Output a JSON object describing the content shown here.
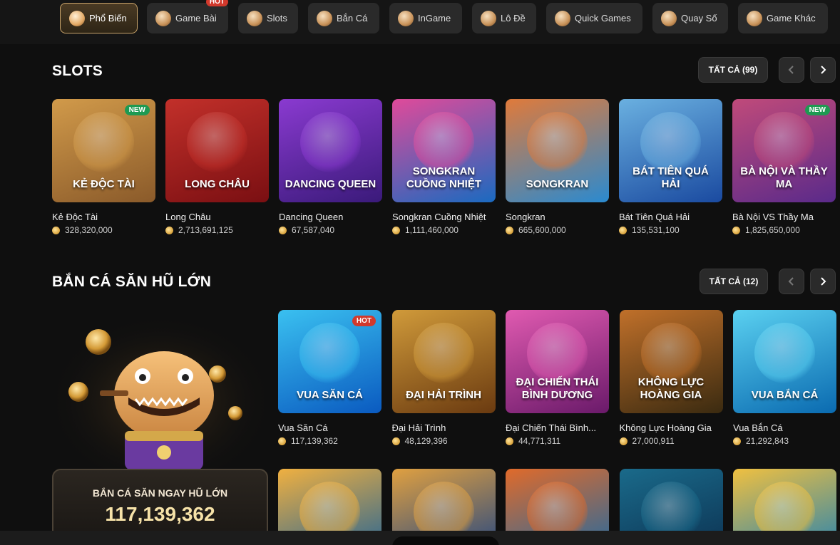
{
  "categories": [
    {
      "label": "Phổ Biến",
      "icon": "fire-icon",
      "active": true
    },
    {
      "label": "Game Bài",
      "icon": "cards-icon",
      "hot": "HOT"
    },
    {
      "label": "Slots",
      "icon": "slot-icon"
    },
    {
      "label": "Bắn Cá",
      "icon": "fish-icon"
    },
    {
      "label": "InGame",
      "icon": "gamepad-icon"
    },
    {
      "label": "Lô Đề",
      "icon": "lottery-ball-icon"
    },
    {
      "label": "Quick Games",
      "icon": "rocket-icon"
    },
    {
      "label": "Quay Số",
      "icon": "dice-icon"
    },
    {
      "label": "Game Khác",
      "icon": "controller-icon"
    }
  ],
  "slots": {
    "title": "SLOTS",
    "all_label": "TẤT CẢ (99)",
    "games": [
      {
        "thumb_title": "KẺ ĐỘC TÀI",
        "name": "Kẻ Độc Tài",
        "amount": "328,320,000",
        "badge": "NEW",
        "color1": "#8a5a2a",
        "color2": "#d19a4a"
      },
      {
        "thumb_title": "LONG CHÂU",
        "name": "Long Châu",
        "amount": "2,713,691,125",
        "color1": "#7a0f12",
        "color2": "#c2302a"
      },
      {
        "thumb_title": "DANCING QUEEN",
        "name": "Dancing Queen",
        "amount": "67,587,040",
        "color1": "#3a1a7a",
        "color2": "#8a3ad0"
      },
      {
        "thumb_title": "SONGKRAN CUỒNG NHIỆT",
        "name": "Songkran Cuồng Nhiệt",
        "amount": "1,111,460,000",
        "color1": "#1a6ac0",
        "color2": "#e04a9a"
      },
      {
        "thumb_title": "SONGKRAN",
        "name": "Songkran",
        "amount": "665,600,000",
        "color1": "#2a8ad0",
        "color2": "#e07a3a"
      },
      {
        "thumb_title": "BÁT TIÊN QUÁ HẢI",
        "name": "Bát Tiên Quá Hải",
        "amount": "135,531,100",
        "color1": "#1a4aa0",
        "color2": "#6ab0e0"
      },
      {
        "thumb_title": "BÀ NỘI VÀ THẦY MA",
        "name": "Bà Nội VS Thầy Ma",
        "amount": "1,825,650,000",
        "badge": "NEW",
        "color1": "#5a2a8a",
        "color2": "#c04a7a"
      }
    ]
  },
  "fishing": {
    "title": "BẮN CÁ SĂN HŨ LỚN",
    "all_label": "TẤT CẢ (12)",
    "promo_label": "BẮN CÁ SĂN NGAY HŨ LỚN",
    "promo_value": "117,139,362",
    "games": [
      {
        "thumb_title": "VUA SĂN CÁ",
        "name": "Vua Săn Cá",
        "amount": "117,139,362",
        "badge": "HOT",
        "color1": "#0a5ac0",
        "color2": "#3ac0f0"
      },
      {
        "thumb_title": "ĐẠI HẢI TRÌNH",
        "name": "Đại Hải Trình",
        "amount": "48,129,396",
        "color1": "#6a3a10",
        "color2": "#d09a3a"
      },
      {
        "thumb_title": "ĐẠI CHIẾN THÁI BÌNH DƯƠNG",
        "name": "Đại Chiến Thái Bình...",
        "amount": "44,771,311",
        "color1": "#6a1a6a",
        "color2": "#e05ab0"
      },
      {
        "thumb_title": "KHÔNG LỰC HOÀNG GIA",
        "name": "Không Lực Hoàng Gia",
        "amount": "27,000,911",
        "color1": "#3a2a10",
        "color2": "#c0702a"
      },
      {
        "thumb_title": "VUA BẮN CÁ",
        "name": "Vua Bắn Cá",
        "amount": "21,292,843",
        "color1": "#0a6ab0",
        "color2": "#5ad0f0"
      }
    ],
    "row2": [
      {
        "icon": "fish-character-icon",
        "color1": "#0a5aa0",
        "color2": "#f0b040"
      },
      {
        "icon": "jet-icon",
        "color1": "#0a3a8a",
        "color2": "#e0a040"
      },
      {
        "icon": "clownfish-icon",
        "color1": "#0a6ab0",
        "color2": "#e06a2a"
      },
      {
        "icon": "deep-sea-icon",
        "color1": "#0a2a4a",
        "color2": "#1a6a8a"
      },
      {
        "icon": "shark-pirate-icon",
        "color1": "#0a7ac0",
        "color2": "#f0c040"
      }
    ]
  }
}
